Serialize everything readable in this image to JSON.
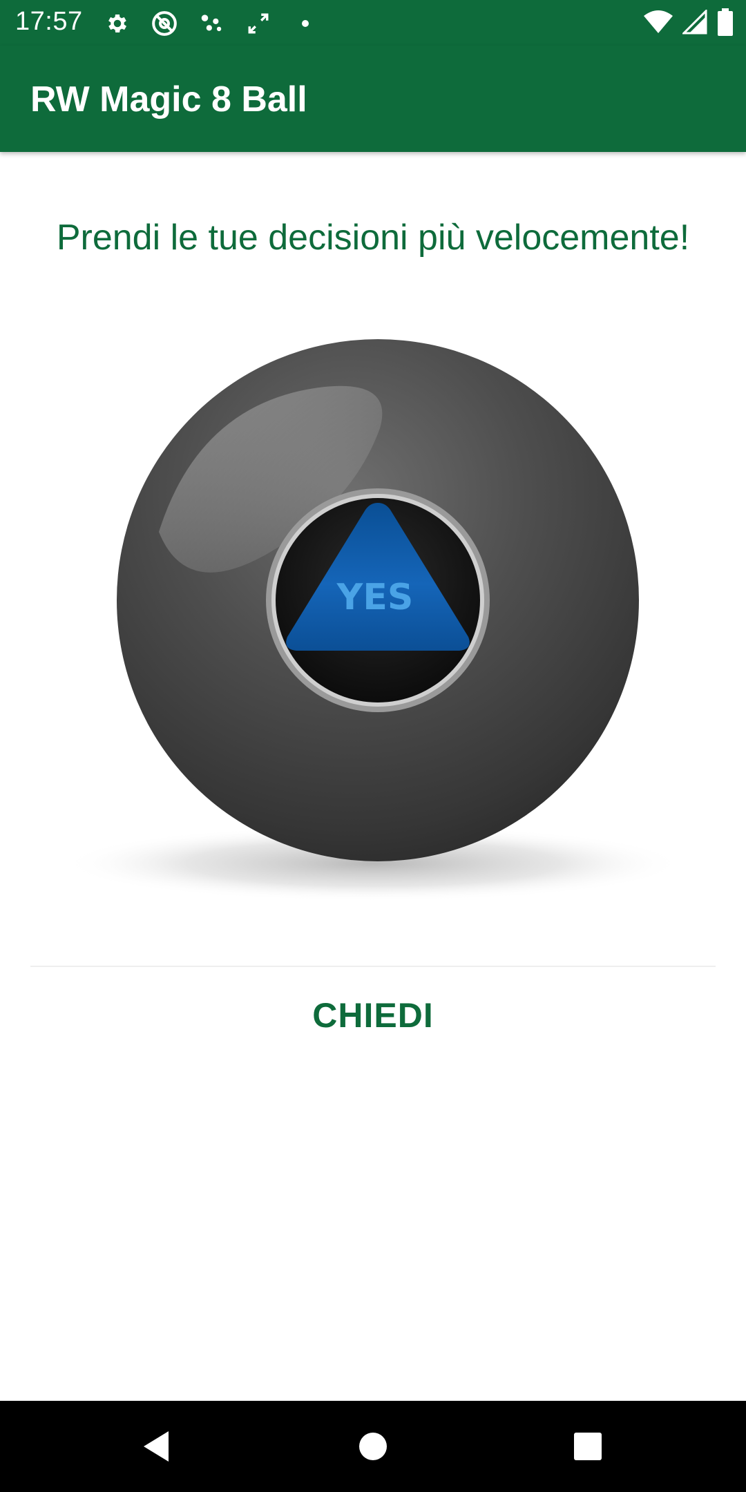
{
  "status_bar": {
    "time": "17:57",
    "left_icons": [
      "settings-icon",
      "at-sign-icon",
      "dots-icon",
      "sync-icon",
      "dot-icon"
    ],
    "right_icons": [
      "wifi-icon",
      "signal-icon",
      "battery-icon"
    ]
  },
  "app_bar": {
    "title": "RW Magic 8 Ball"
  },
  "main": {
    "headline": "Prendi le tue decisioni più velocemente!",
    "answer": "YES",
    "ask_button_label": "CHIEDI"
  },
  "nav_bar": {
    "buttons": [
      "back-icon",
      "home-icon",
      "recents-icon"
    ]
  },
  "colors": {
    "primary": "#0e6b3b",
    "answer_blue": "#1565b8",
    "answer_text": "#4aa3e6"
  }
}
